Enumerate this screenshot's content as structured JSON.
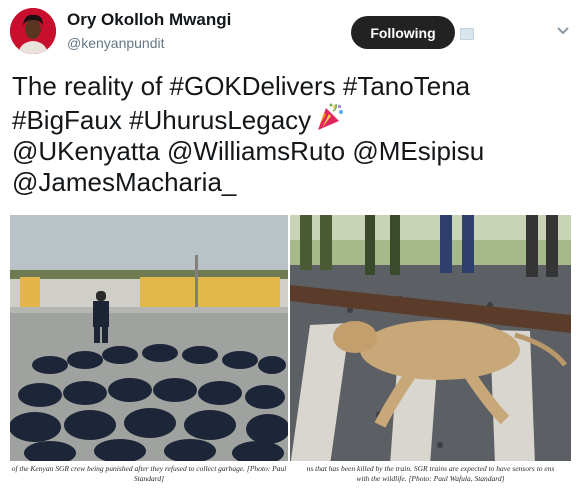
{
  "header": {
    "display_name": "Ory Okolloh Mwangi",
    "handle": "@kenyanpundit",
    "follow_button_label": "Following"
  },
  "tweet": {
    "lines": [
      "The reality of #GOKDelivers #TanoTena",
      "#BigFaux #UhurusLegacy",
      "@UKenyatta @WilliamsRuto @MEsipisu",
      "@JamesMacharia_"
    ]
  },
  "media": {
    "left_caption_line1": "of the Kenyan SGR crew being punished after they refused to collect garbage. [Photo: Paul",
    "left_caption_line2": "Standard]",
    "right_caption_line1": "ns that has been killed by the train. SGR trains are expected to have sensors to ens",
    "right_caption_line2": "with the wildlife. [Photo: Paul Wafula, Standard]"
  },
  "icons": [
    "avatar",
    "party-popper-icon",
    "chevron-down-icon",
    "broken-image-icon"
  ],
  "colors": {
    "button_bg": "#222222",
    "handle_gray": "#657786",
    "text": "#14171a"
  }
}
